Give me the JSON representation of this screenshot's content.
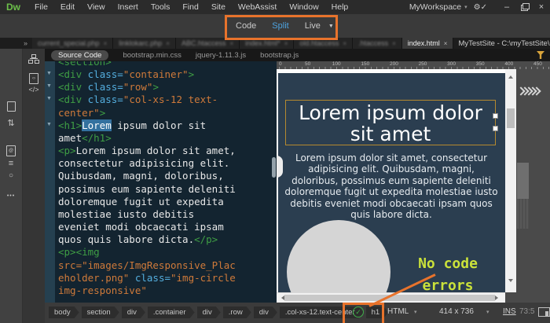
{
  "titlebar": {
    "logo": "Dw",
    "menus": [
      "File",
      "Edit",
      "View",
      "Insert",
      "Tools",
      "Find",
      "Site",
      "WebAssist",
      "Window",
      "Help"
    ],
    "workspace": "MyWorkspace",
    "controls": {
      "minimize": "–",
      "close": "×"
    },
    "sync_icon_glyph": "⚙✓"
  },
  "viewbar": {
    "modes": [
      "Code",
      "Split",
      "Live"
    ],
    "active": "Split",
    "caret_glyph": "▼"
  },
  "tabbar": {
    "overflow_glyph": "»",
    "close_glyph": "×",
    "tabs": [
      {
        "label": "current_special.php",
        "blurred": true,
        "active": false
      },
      {
        "label": "linklokarc.php",
        "blurred": true,
        "active": false
      },
      {
        "label": "ABC.htaccess",
        "blurred": true,
        "active": false
      },
      {
        "label": "index.html*",
        "blurred": true,
        "active": false
      },
      {
        "label": "old.htaccess",
        "blurred": true,
        "active": false
      },
      {
        "label": ".htaccess",
        "blurred": true,
        "active": false
      },
      {
        "label": "index.html",
        "blurred": false,
        "active": true
      }
    ],
    "title_path": "MyTestSite - C:\\myTestSite\\index.html"
  },
  "related_files": {
    "selected": "Source Code",
    "items": [
      "Source Code",
      "bootstrap.min.css",
      "jquery-1.11.3.js",
      "bootstrap.js"
    ]
  },
  "sidebar": {
    "left_icons": [
      "new-file-icon",
      "swap-vertical-icon",
      "file-preview-icon",
      "align-lines-icon",
      "target-circle-icon",
      "more-icon"
    ],
    "glyphs": {
      "swap": "⇅",
      "lines": "≡",
      "circle": "○",
      "more": "•••",
      "code_tag": "</>"
    },
    "inner_icons": [
      "sitemap-icon",
      "file-code-icon",
      "code-tag-icon"
    ]
  },
  "code": {
    "fold_glyph": "▼",
    "lines": [
      {
        "fold": false,
        "tokens": [
          [
            "tag",
            "<section>"
          ]
        ]
      },
      {
        "fold": true,
        "tokens": [
          [
            "tag",
            "<div "
          ],
          [
            "attr",
            "class="
          ],
          [
            "val",
            "\"container\""
          ],
          [
            "tag",
            ">"
          ]
        ]
      },
      {
        "fold": true,
        "tokens": [
          [
            "tag",
            "<div "
          ],
          [
            "attr",
            "class="
          ],
          [
            "val",
            "\"row\""
          ],
          [
            "tag",
            ">"
          ]
        ]
      },
      {
        "fold": true,
        "tokens": [
          [
            "tag",
            "<div "
          ],
          [
            "attr",
            "class="
          ],
          [
            "val",
            "\"col-xs-12 text-"
          ]
        ]
      },
      {
        "fold": false,
        "tokens": [
          [
            "val",
            "center\""
          ],
          [
            "tag",
            ">"
          ]
        ]
      },
      {
        "fold": true,
        "tokens": [
          [
            "tag",
            "<h1>"
          ],
          [
            "sel",
            "Lorem"
          ],
          [
            "txt",
            " ipsum dolor sit"
          ]
        ]
      },
      {
        "fold": false,
        "tokens": [
          [
            "txt",
            "amet"
          ],
          [
            "tag",
            "</h1>"
          ]
        ]
      },
      {
        "fold": false,
        "tokens": [
          [
            "tag",
            "<p>"
          ],
          [
            "txt",
            "Lorem ipsum dolor sit amet,"
          ]
        ]
      },
      {
        "fold": false,
        "tokens": [
          [
            "txt",
            "consectetur adipisicing elit."
          ]
        ]
      },
      {
        "fold": false,
        "tokens": [
          [
            "txt",
            "Quibusdam, magni, doloribus,"
          ]
        ]
      },
      {
        "fold": false,
        "tokens": [
          [
            "txt",
            "possimus eum sapiente deleniti"
          ]
        ]
      },
      {
        "fold": false,
        "tokens": [
          [
            "txt",
            "doloremque fugit ut expedita"
          ]
        ]
      },
      {
        "fold": false,
        "tokens": [
          [
            "txt",
            "molestiae iusto debitis"
          ]
        ]
      },
      {
        "fold": false,
        "tokens": [
          [
            "txt",
            "eveniet modi obcaecati ipsam"
          ]
        ]
      },
      {
        "fold": false,
        "tokens": [
          [
            "txt",
            "quos quis labore dicta."
          ],
          [
            "tag",
            "</p>"
          ]
        ]
      },
      {
        "fold": false,
        "tokens": [
          [
            "tag",
            "<p><img"
          ]
        ]
      },
      {
        "fold": false,
        "tokens": [
          [
            "val",
            "src=\"images/ImgResponsive_Plac"
          ]
        ]
      },
      {
        "fold": false,
        "tokens": [
          [
            "val",
            "eholder.png\" "
          ],
          [
            "attr",
            "class="
          ],
          [
            "val",
            "\"img-circle"
          ]
        ]
      },
      {
        "fold": false,
        "tokens": [
          [
            "val",
            "img-responsive\""
          ]
        ]
      }
    ]
  },
  "live": {
    "ruler_labels": [
      "0",
      "50",
      "100",
      "150",
      "200",
      "250",
      "300",
      "350",
      "400",
      "450"
    ],
    "heading": "Lorem ipsum dolor sit amet",
    "paragraph": "Lorem ipsum dolor sit amet, consectetur adipisicing elit. Quibusdam, magni, doloribus, possimus eum sapiente deleniti doloremque fugit ut expedita molestiae iusto debitis eveniet modi obcaecati ipsam quos quis labore dicta."
  },
  "statusbar": {
    "breadcrumbs": [
      "body",
      "section",
      "div",
      ".container",
      "div",
      ".row",
      "div",
      ".col-xs-12.text-center",
      "h1"
    ],
    "check_glyph": "✓",
    "syntax": "HTML",
    "viewport_size": "414 x 736",
    "insert_mode": "INS",
    "cursor_position": "73:5"
  },
  "annotation": {
    "line1": "No code",
    "line2": "errors",
    "accent_color": "#e8732c",
    "text_color": "#cbe23a"
  }
}
